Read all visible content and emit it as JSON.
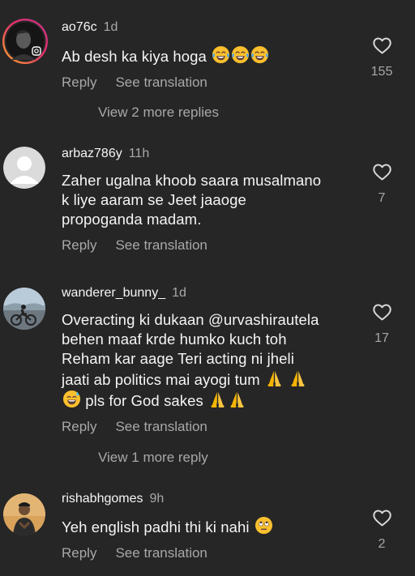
{
  "comments": [
    {
      "username": "ao76c",
      "time": "1d",
      "text": "Ab desh ka kiya hoga ",
      "emojis": [
        "joy",
        "joy",
        "joy"
      ],
      "reply_label": "Reply",
      "translate_label": "See translation",
      "likes": "155"
    },
    {
      "username": "arbaz786y",
      "time": "11h",
      "lines": [
        "Zaher ugalna khoob saara musalmano",
        "k liye aaram se Jeet jaaoge",
        "propoganda madam."
      ],
      "reply_label": "Reply",
      "translate_label": "See translation",
      "likes": "7"
    },
    {
      "username": "wanderer_bunny_",
      "time": "1d",
      "lines": [
        "Overacting ki dukaan @urvashirautela",
        "behen maaf krde humko kuch toh",
        "Reham kar aage Teri acting ni jheli",
        "jaati ab politics mai ayogi tum ",
        " pls for God sakes "
      ],
      "reply_label": "Reply",
      "translate_label": "See translation",
      "likes": "17"
    },
    {
      "username": "rishabhgomes",
      "time": "9h",
      "text": "Yeh english padhi thi ki nahi ",
      "reply_label": "Reply",
      "translate_label": "See translation",
      "likes": "2"
    }
  ],
  "view_replies_1": "View 2 more replies",
  "view_replies_2": "View 1 more reply",
  "icons": {
    "heart": "heart-outline-icon",
    "instagram": "instagram-icon",
    "emoji_joy": "face-with-tears-of-joy",
    "emoji_pray": "folded-hands",
    "emoji_sweat": "grinning-face-with-sweat",
    "emoji_eyeroll": "face-with-rolling-eyes"
  },
  "colors": {
    "background": "#262626",
    "primary_text": "#f5f5f5",
    "secondary_text": "#a8a8a8",
    "story_ring_start": "#f9a825",
    "story_ring_end": "#d6249f"
  }
}
